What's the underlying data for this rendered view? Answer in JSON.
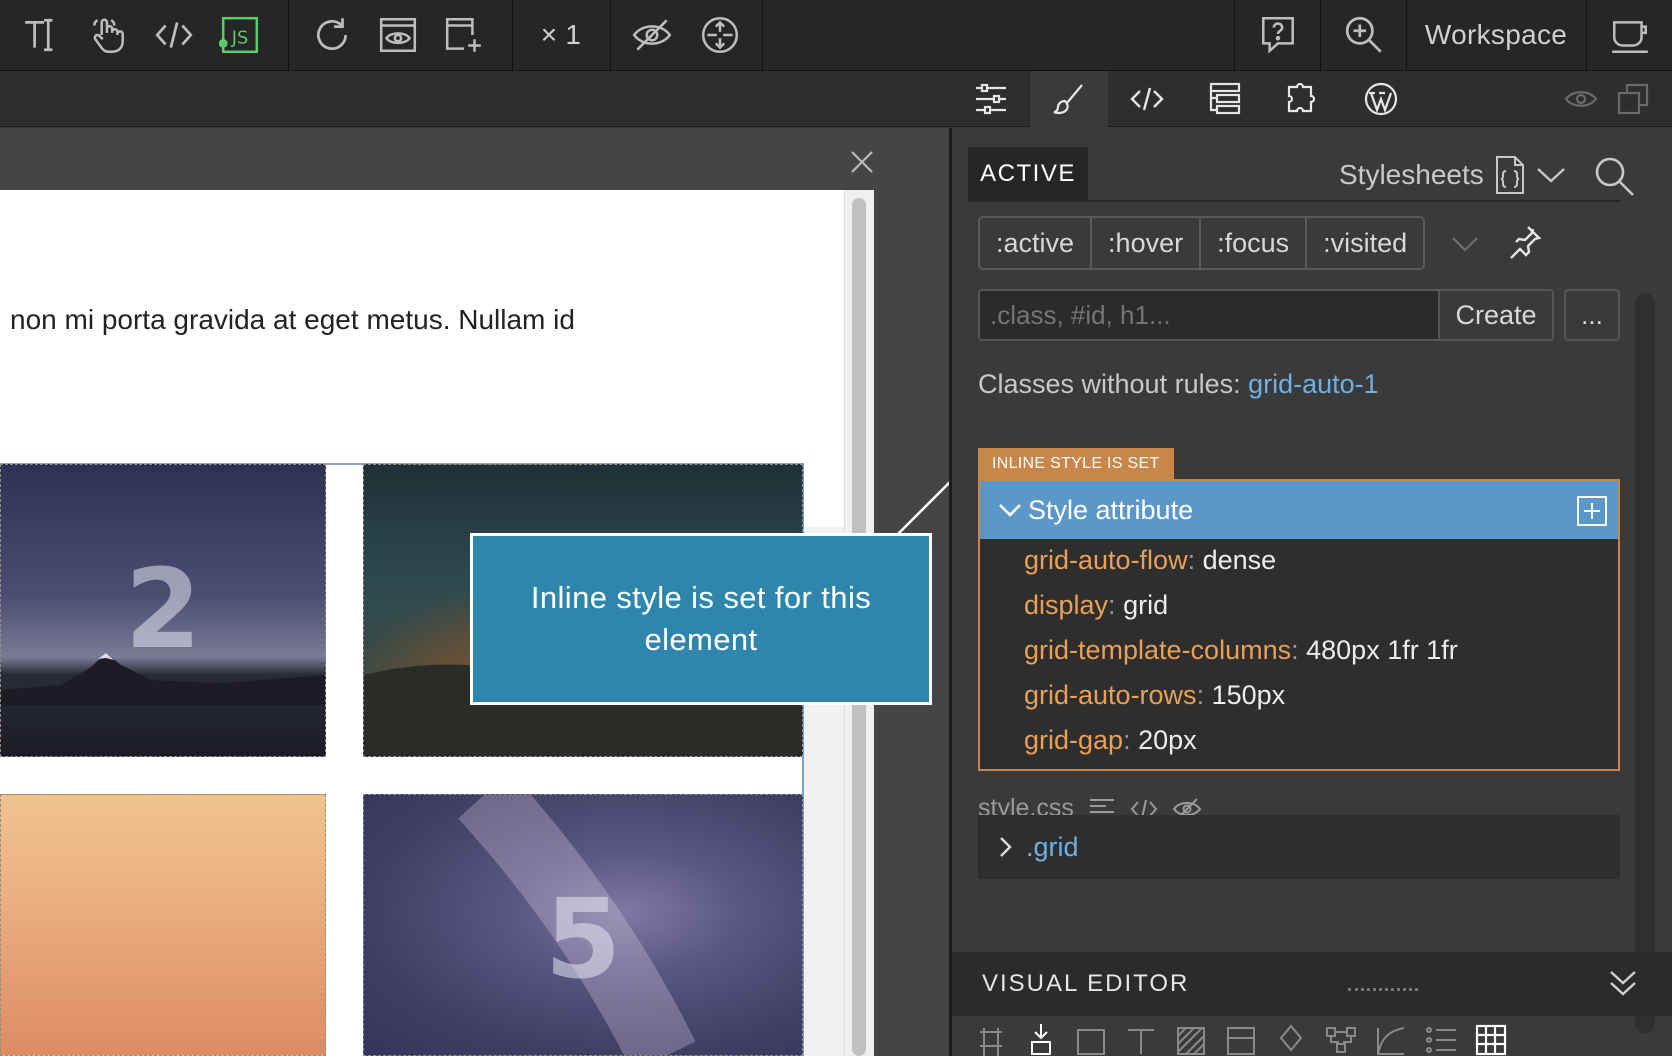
{
  "toolbar": {
    "zoom_multiplier": "× 1",
    "workspace_label": "Workspace",
    "js_badge": "JS"
  },
  "canvas": {
    "paragraph_text": "non mi porta gravida at eget metus. Nullam id",
    "tiles": [
      {
        "label": "2"
      },
      {
        "label": ""
      },
      {
        "label": ""
      },
      {
        "label": "5"
      }
    ],
    "callout_text": "Inline style is set for this element"
  },
  "panel": {
    "active_tab": "ACTIVE",
    "stylesheets_label": "Stylesheets",
    "pseudo_classes": [
      ":active",
      ":hover",
      ":focus",
      ":visited"
    ],
    "selector_placeholder": ".class, #id, h1...",
    "create_label": "Create",
    "more_label": "...",
    "classes_prefix": "Classes without rules: ",
    "classes_value": "grid-auto-1",
    "inline_badge": "INLINE STYLE IS SET",
    "rule_title": "Style attribute",
    "properties": [
      {
        "name": "grid-auto-flow",
        "value": "dense"
      },
      {
        "name": "display",
        "value": "grid"
      },
      {
        "name": "grid-template-columns",
        "value": "480px 1fr 1fr"
      },
      {
        "name": "grid-auto-rows",
        "value": "150px"
      },
      {
        "name": "grid-gap",
        "value": "20px"
      }
    ],
    "stylesheet_name": "style.css",
    "grid_rule": ".grid",
    "visual_editor_label": "VISUAL EDITOR"
  },
  "colors": {
    "accent_blue": "#5b97c9",
    "inline_orange": "#c8864a",
    "property_name": "#e9a055",
    "link_blue": "#6fb0e3",
    "callout_bg": "#2f86ad",
    "js_green": "#5cc96b"
  }
}
